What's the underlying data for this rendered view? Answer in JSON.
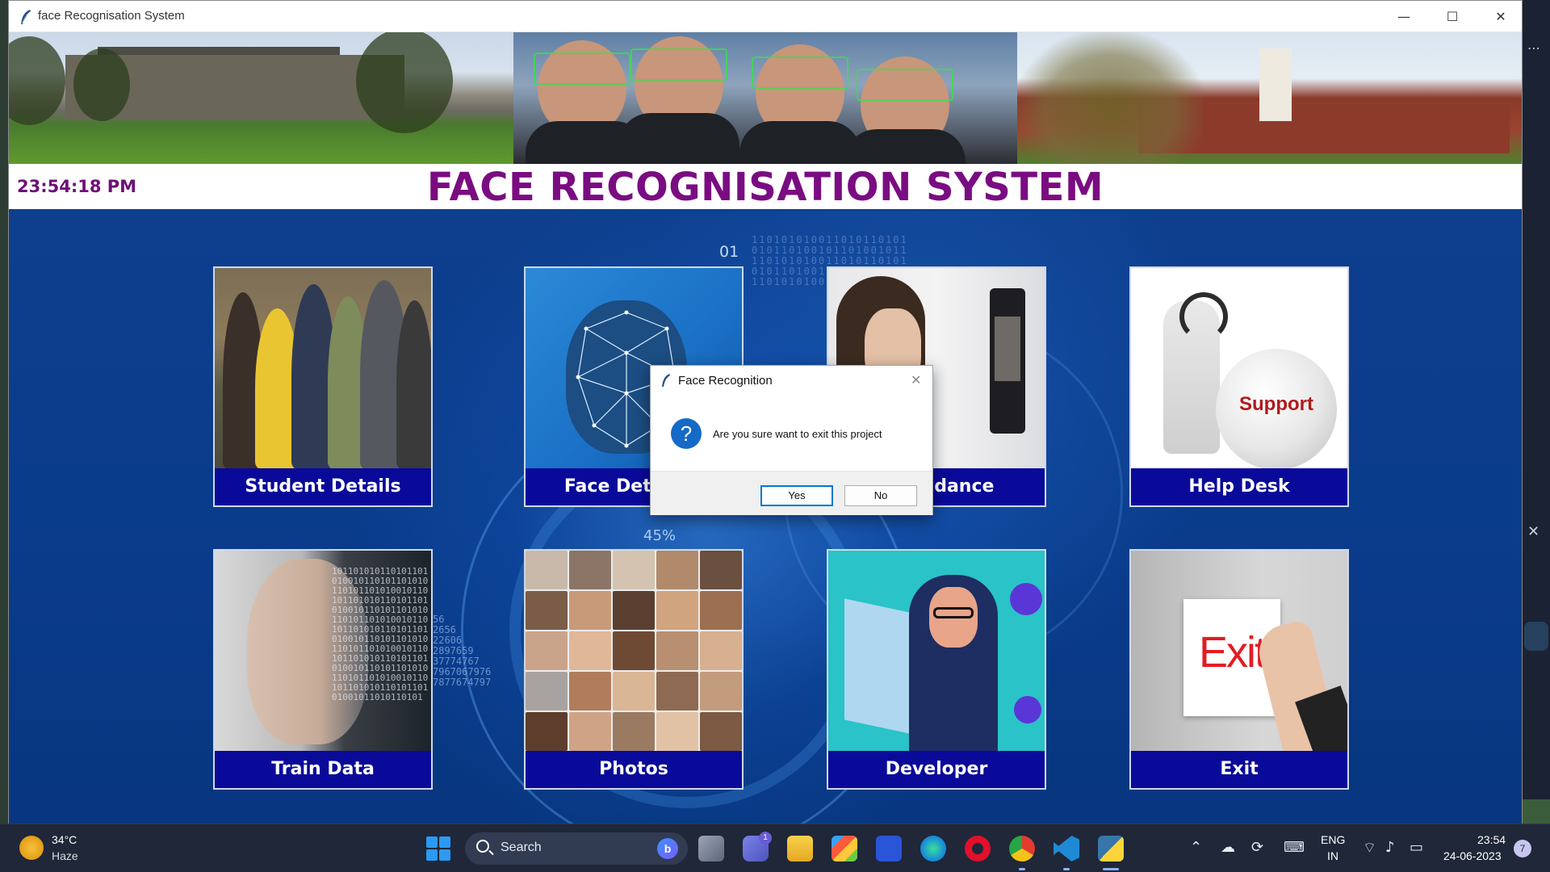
{
  "window": {
    "title": "face Recognisation System",
    "controls": {
      "minimize": "—",
      "maximize": "☐",
      "close": "✕"
    }
  },
  "header": {
    "clock": "23:54:18 PM",
    "title": "FACE RECOGNISATION SYSTEM"
  },
  "background": {
    "label_01": "01",
    "label_pct": "45%"
  },
  "tiles": [
    {
      "label": "Student Details"
    },
    {
      "label": "Face Detector"
    },
    {
      "label": "Attendance"
    },
    {
      "label": "Help Desk"
    },
    {
      "label": "Train Data"
    },
    {
      "label": "Photos"
    },
    {
      "label": "Developer"
    },
    {
      "label": "Exit"
    }
  ],
  "tile_art": {
    "support_text": "Support",
    "exit_card_text": "Exit"
  },
  "dialog": {
    "title": "Face Recognition",
    "close": "✕",
    "icon": "?",
    "message": "Are you sure want to exit this project",
    "yes_label": "Yes",
    "no_label": "No"
  },
  "taskbar": {
    "weather_temp": "34°C",
    "weather_desc": "Haze",
    "search_placeholder": "Search",
    "bing_label": "b",
    "teams_badge": "1",
    "language_top": "ENG",
    "language_bottom": "IN",
    "time": "23:54",
    "date": "24-06-2023",
    "notification_count": "7"
  },
  "desktop": {
    "right_dots": "⋯",
    "right_close": "✕"
  },
  "colors": {
    "title_purple": "#7a0c82",
    "tile_label_bg": "#0a0a9a",
    "main_blue": "#0b3f8f",
    "dialog_accent": "#0078d4"
  }
}
